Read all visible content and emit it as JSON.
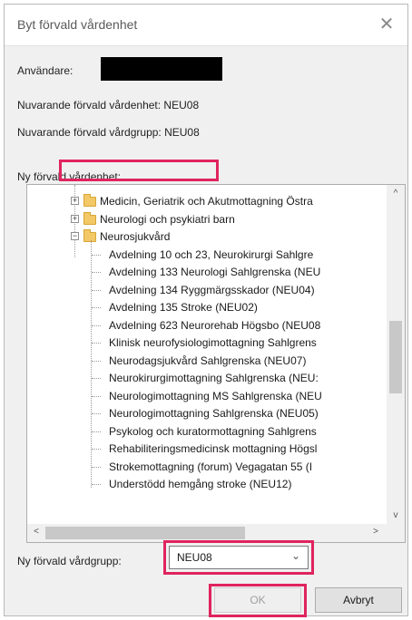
{
  "dialog": {
    "title": "Byt förvald vårdenhet",
    "close_glyph": "✕",
    "user_label": "Användare:",
    "current_unit": "Nuvarande förvald vårdenhet: NEU08",
    "current_group": "Nuvarande förvald vårdgrupp: NEU08",
    "new_unit_label": "Ny förvald vårdenhet:",
    "new_group_label": "Ny förvald vårdgrupp:",
    "group_select_value": "NEU08",
    "ok_label": "OK",
    "cancel_label": "Avbryt"
  },
  "tree": {
    "folders": [
      {
        "label": "Medicin, Geriatrik och Akutmottagning Östra",
        "expander": "+"
      },
      {
        "label": "Neurologi och psykiatri barn",
        "expander": "+"
      },
      {
        "label": "Neurosjukvård",
        "expander": "−"
      }
    ],
    "children": [
      "Avdelning 10 och 23, Neurokirurgi  Sahlgre",
      "Avdelning 133 Neurologi Sahlgrenska (NEU",
      "Avdelning 134 Ryggmärgsskador (NEU04)",
      "Avdelning 135 Stroke (NEU02)",
      "Avdelning 623 Neurorehab Högsbo (NEU08",
      "Klinisk neurofysiologimottagning Sahlgrens",
      "Neurodagsjukvård Sahlgrenska (NEU07)",
      "Neurokirurgimottagning Sahlgrenska (NEU:",
      "Neurologimottagning MS Sahlgrenska (NEU",
      "Neurologimottagning Sahlgrenska (NEU05)",
      "Psykolog och kuratormottagning Sahlgrens",
      "Rehabiliteringsmedicinsk mottagning Högsl",
      "Strokemottagning (forum) Vegagatan 55 (I",
      "Understödd hemgång stroke (NEU12)"
    ]
  },
  "scroll": {
    "up": "^",
    "down": "v",
    "left": "<",
    "right": ">"
  },
  "colors": {
    "highlight": "#e0245e",
    "redaction": "#000000",
    "folder": "#f3c867"
  }
}
